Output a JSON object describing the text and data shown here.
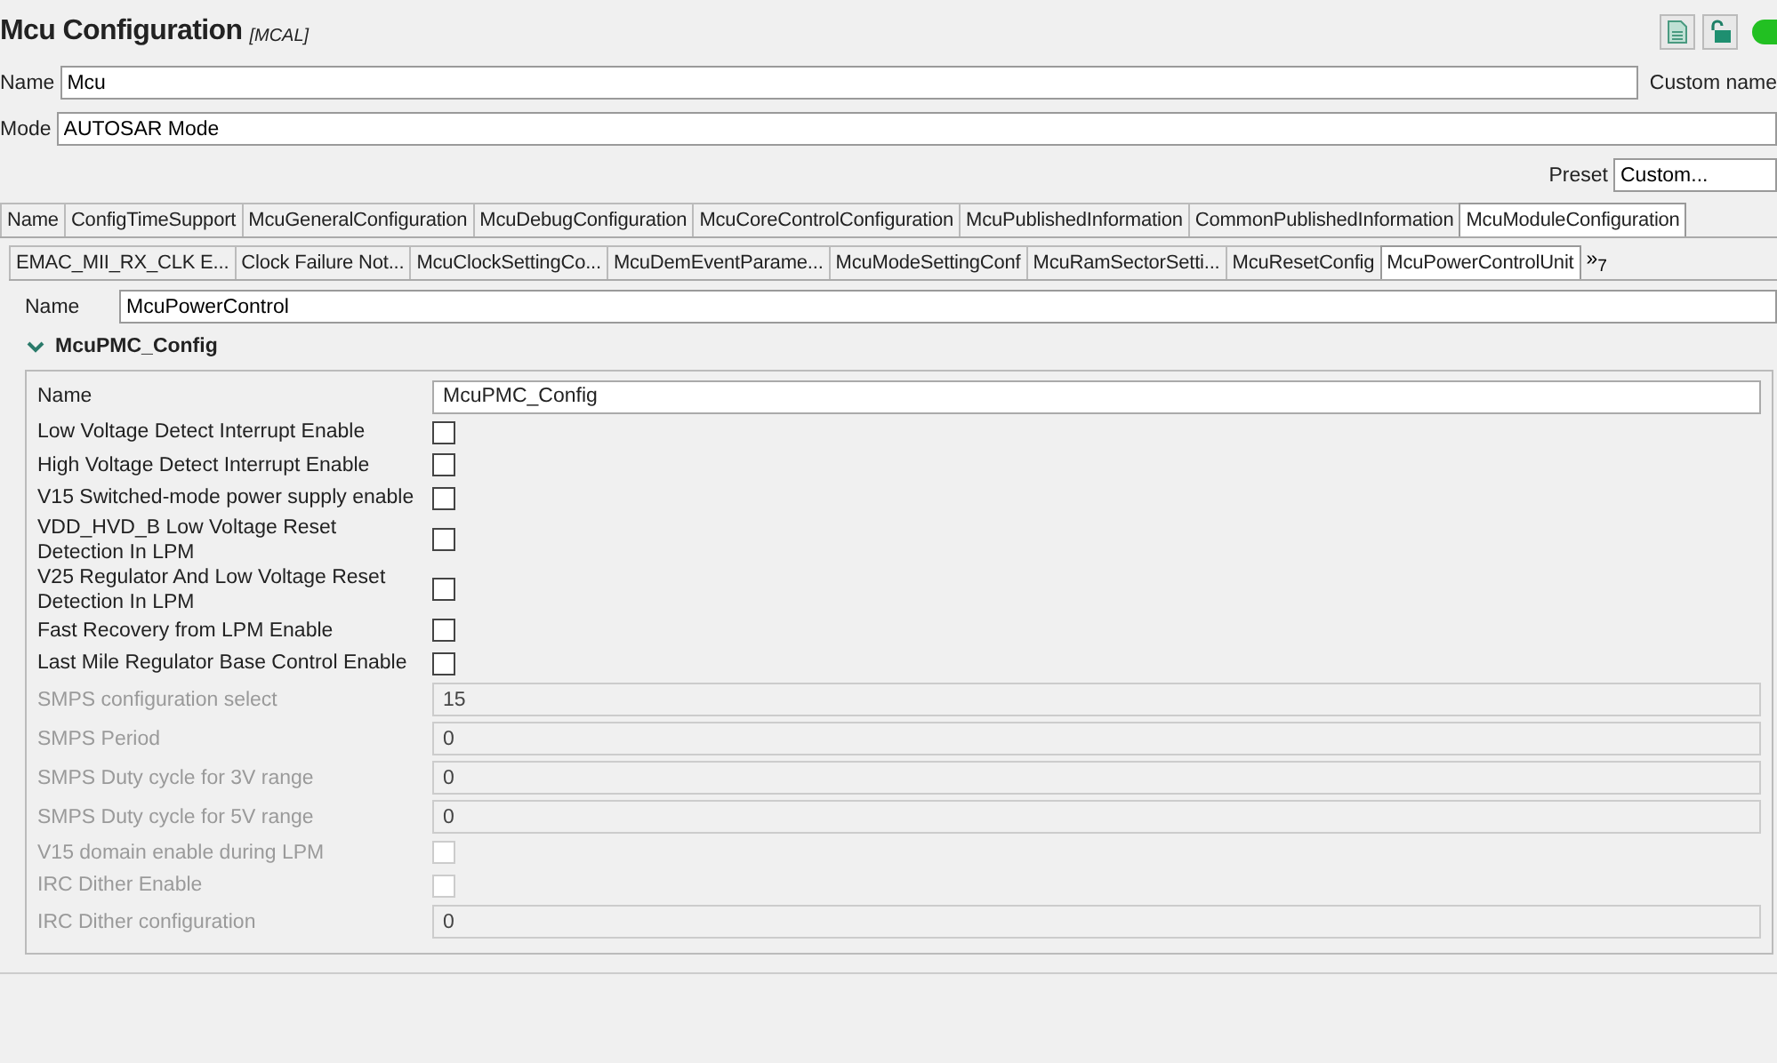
{
  "header": {
    "title": "Mcu Configuration",
    "tag": "[MCAL]",
    "status_on": true
  },
  "name_field": {
    "label": "Name",
    "value": "Mcu",
    "custom_label": "Custom name"
  },
  "mode_field": {
    "label": "Mode",
    "value": "AUTOSAR Mode"
  },
  "preset": {
    "label": "Preset",
    "value": "Custom..."
  },
  "tabs": [
    {
      "label": "Name",
      "selected": false
    },
    {
      "label": "ConfigTimeSupport",
      "selected": false
    },
    {
      "label": "McuGeneralConfiguration",
      "selected": false
    },
    {
      "label": "McuDebugConfiguration",
      "selected": false
    },
    {
      "label": "McuCoreControlConfiguration",
      "selected": false
    },
    {
      "label": "McuPublishedInformation",
      "selected": false
    },
    {
      "label": "CommonPublishedInformation",
      "selected": false
    },
    {
      "label": "McuModuleConfiguration",
      "selected": true
    }
  ],
  "subtabs": [
    {
      "label": "EMAC_MII_RX_CLK E...",
      "selected": false
    },
    {
      "label": "Clock Failure Not...",
      "selected": false
    },
    {
      "label": "McuClockSettingCo...",
      "selected": false
    },
    {
      "label": "McuDemEventParame...",
      "selected": false
    },
    {
      "label": "McuModeSettingConf",
      "selected": false
    },
    {
      "label": "McuRamSectorSetti...",
      "selected": false
    },
    {
      "label": "McuResetConfig",
      "selected": false
    },
    {
      "label": "McuPowerControlUnit",
      "selected": true
    }
  ],
  "subtabs_more": {
    "symbol": "»",
    "count": "7"
  },
  "unit_name": {
    "label": "Name",
    "value": "McuPowerControl"
  },
  "section": {
    "title": "McuPMC_Config",
    "expanded": true,
    "fields": [
      {
        "kind": "text",
        "label": "Name",
        "value": "McuPMC_Config",
        "disabled": false
      },
      {
        "kind": "checkbox",
        "label": "Low Voltage Detect Interrupt Enable",
        "checked": false,
        "disabled": false
      },
      {
        "kind": "checkbox",
        "label": "High Voltage Detect Interrupt Enable",
        "checked": false,
        "disabled": false
      },
      {
        "kind": "checkbox",
        "label": "V15 Switched-mode power supply enable",
        "checked": false,
        "disabled": false
      },
      {
        "kind": "checkbox",
        "label": "VDD_HVD_B Low Voltage Reset Detection In LPM",
        "checked": false,
        "disabled": false
      },
      {
        "kind": "checkbox",
        "label": "V25 Regulator And Low Voltage Reset Detection In LPM",
        "checked": false,
        "disabled": false
      },
      {
        "kind": "checkbox",
        "label": "Fast Recovery from LPM Enable",
        "checked": false,
        "disabled": false
      },
      {
        "kind": "checkbox",
        "label": "Last Mile Regulator Base Control Enable",
        "checked": false,
        "disabled": false
      },
      {
        "kind": "text",
        "label": "SMPS configuration select",
        "value": "15",
        "disabled": true
      },
      {
        "kind": "text",
        "label": "SMPS Period",
        "value": "0",
        "disabled": true
      },
      {
        "kind": "text",
        "label": "SMPS Duty cycle for 3V range",
        "value": "0",
        "disabled": true
      },
      {
        "kind": "text",
        "label": "SMPS Duty cycle for 5V range",
        "value": "0",
        "disabled": true
      },
      {
        "kind": "checkbox",
        "label": "V15 domain enable during LPM",
        "checked": false,
        "disabled": true
      },
      {
        "kind": "checkbox",
        "label": "IRC Dither Enable",
        "checked": false,
        "disabled": true
      },
      {
        "kind": "text",
        "label": "IRC Dither configuration",
        "value": "0",
        "disabled": true
      }
    ]
  }
}
